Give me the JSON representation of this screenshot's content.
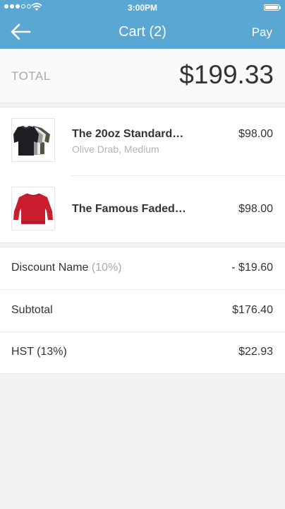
{
  "status_bar": {
    "time": "3:00PM"
  },
  "nav": {
    "title": "Cart (2)",
    "pay_label": "Pay"
  },
  "total": {
    "label": "TOTAL",
    "amount": "$199.33"
  },
  "items": [
    {
      "name": "The 20oz Standard…",
      "variant": "Olive Drab, Medium",
      "price": "$98.00"
    },
    {
      "name": "The Famous Faded…",
      "variant": "",
      "price": "$98.00"
    }
  ],
  "summary": {
    "discount": {
      "label": "Discount Name",
      "percent": "(10%)",
      "value": "- $19.60"
    },
    "subtotal": {
      "label": "Subtotal",
      "value": "$176.40"
    },
    "tax": {
      "label": "HST (13%)",
      "value": "$22.93"
    }
  },
  "colors": {
    "accent": "#5aa7d3",
    "background": "#f2f2f4"
  },
  "icons": [
    "signal-dots-icon",
    "wifi-icon",
    "battery-icon",
    "back-arrow-icon"
  ]
}
